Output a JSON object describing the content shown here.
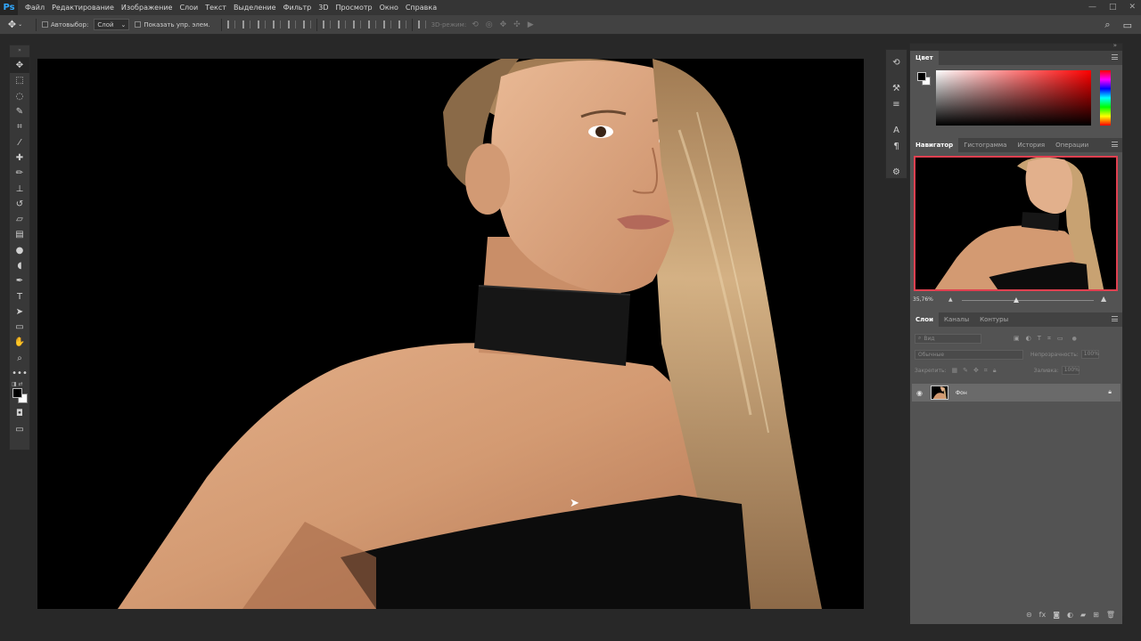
{
  "app": {
    "logo": "Ps"
  },
  "menu": [
    "Файл",
    "Редактирование",
    "Изображение",
    "Слои",
    "Текст",
    "Выделение",
    "Фильтр",
    "3D",
    "Просмотр",
    "Окно",
    "Справка"
  ],
  "window_controls": {
    "minimize": "—",
    "maximize": "□",
    "close": "✕"
  },
  "options_bar": {
    "autoselect_label": "Автовыбор:",
    "autoselect_value": "Слой",
    "show_transform_label": "Показать упр. элем.",
    "mode_3d_label": "3D-режим:"
  },
  "tools": [
    {
      "name": "move-tool",
      "glyph": "✥",
      "active": true
    },
    {
      "name": "marquee-tool",
      "glyph": "⬚"
    },
    {
      "name": "lasso-tool",
      "glyph": "◌"
    },
    {
      "name": "quick-select-tool",
      "glyph": "✎"
    },
    {
      "name": "crop-tool",
      "glyph": "⌗"
    },
    {
      "name": "eyedropper-tool",
      "glyph": "⁄"
    },
    {
      "name": "healing-brush-tool",
      "glyph": "✚"
    },
    {
      "name": "brush-tool",
      "glyph": "✏"
    },
    {
      "name": "clone-stamp-tool",
      "glyph": "⊥"
    },
    {
      "name": "history-brush-tool",
      "glyph": "↺"
    },
    {
      "name": "eraser-tool",
      "glyph": "▱"
    },
    {
      "name": "gradient-tool",
      "glyph": "▤"
    },
    {
      "name": "blur-tool",
      "glyph": "●"
    },
    {
      "name": "dodge-tool",
      "glyph": "◖"
    },
    {
      "name": "pen-tool",
      "glyph": "✒"
    },
    {
      "name": "type-tool",
      "glyph": "T"
    },
    {
      "name": "path-select-tool",
      "glyph": "➤"
    },
    {
      "name": "rectangle-tool",
      "glyph": "▭"
    },
    {
      "name": "hand-tool",
      "glyph": "✋"
    },
    {
      "name": "zoom-tool",
      "glyph": "⌕"
    },
    {
      "name": "more-tools",
      "glyph": "•••"
    }
  ],
  "colors": {
    "foreground": "#000000",
    "background": "#ffffff",
    "accent": "#31a8ff",
    "nav_frame": "#e04050"
  },
  "panels": {
    "color_tab": "Цвет",
    "nav_tabs": [
      "Навигатор",
      "Гистограмма",
      "История",
      "Операции"
    ],
    "zoom": "35,76%",
    "layer_tabs": [
      "Слои",
      "Каналы",
      "Контуры"
    ],
    "search_placeholder": "Вид",
    "blend_mode": "Обычные",
    "opacity_label": "Непрозрачность:",
    "opacity_value": "100%",
    "lock_label": "Закрепить:",
    "fill_label": "Заливка:",
    "fill_value": "100%",
    "layers": [
      {
        "name": "Фон",
        "visible": true,
        "locked": true
      }
    ]
  }
}
